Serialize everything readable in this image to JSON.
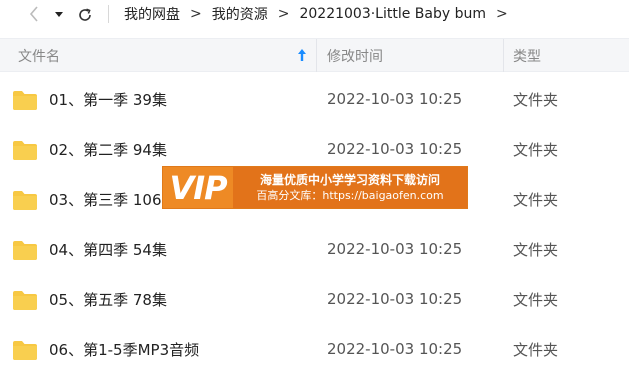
{
  "toolbar": {
    "back_icon": "chevron-left-icon",
    "dropdown_icon": "caret-down-icon",
    "refresh_icon": "refresh-icon"
  },
  "breadcrumb": {
    "items": [
      "我的网盘",
      "我的资源",
      "20221003·Little Baby bum"
    ],
    "separator": ">"
  },
  "columns": {
    "name": "文件名",
    "modified": "修改时间",
    "type": "类型"
  },
  "files": [
    {
      "name": "01、第一季 39集",
      "modified": "2022-10-03 10:25",
      "type": "文件夹"
    },
    {
      "name": "02、第二季 94集",
      "modified": "2022-10-03 10:25",
      "type": "文件夹"
    },
    {
      "name": "03、第三季 106集",
      "modified": "2022-10-03 10:25",
      "type": "文件夹"
    },
    {
      "name": "04、第四季 54集",
      "modified": "2022-10-03 10:25",
      "type": "文件夹"
    },
    {
      "name": "05、第五季 78集",
      "modified": "2022-10-03 10:25",
      "type": "文件夹"
    },
    {
      "name": "06、第1-5季MP3音频",
      "modified": "2022-10-03 10:25",
      "type": "文件夹"
    }
  ],
  "watermark": {
    "badge": "VIP",
    "line1": "海量优质中小学学习资料下载访问",
    "line2": "百高分文库：https://baigaofen.com"
  },
  "colors": {
    "folder": "#f7c843",
    "folder_dark": "#f0b429",
    "sort_arrow": "#1a8cff",
    "watermark_bg": "#e2731a"
  }
}
